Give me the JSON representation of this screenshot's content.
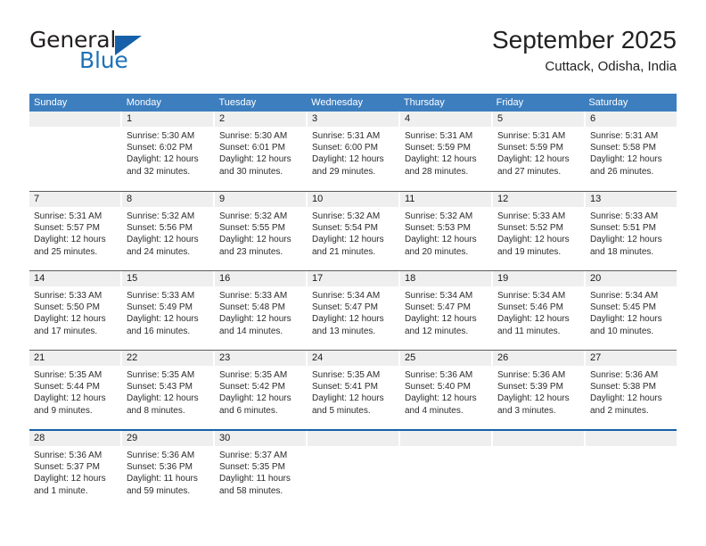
{
  "brand": {
    "name_part1": "General",
    "name_part2": "Blue",
    "flag_icon": "triangle-flag-icon"
  },
  "header": {
    "title": "September 2025",
    "subtitle": "Cuttack, Odisha, India"
  },
  "calendar": {
    "weekday_headers": [
      "Sunday",
      "Monday",
      "Tuesday",
      "Wednesday",
      "Thursday",
      "Friday",
      "Saturday"
    ],
    "accent_color": "#3d7ebf",
    "header_text_color": "#ffffff",
    "day_band_color": "#efefef",
    "weeks": [
      [
        {
          "day": "",
          "empty": true
        },
        {
          "day": "1",
          "sunrise": "Sunrise: 5:30 AM",
          "sunset": "Sunset: 6:02 PM",
          "daylight_line1": "Daylight: 12 hours",
          "daylight_line2": "and 32 minutes."
        },
        {
          "day": "2",
          "sunrise": "Sunrise: 5:30 AM",
          "sunset": "Sunset: 6:01 PM",
          "daylight_line1": "Daylight: 12 hours",
          "daylight_line2": "and 30 minutes."
        },
        {
          "day": "3",
          "sunrise": "Sunrise: 5:31 AM",
          "sunset": "Sunset: 6:00 PM",
          "daylight_line1": "Daylight: 12 hours",
          "daylight_line2": "and 29 minutes."
        },
        {
          "day": "4",
          "sunrise": "Sunrise: 5:31 AM",
          "sunset": "Sunset: 5:59 PM",
          "daylight_line1": "Daylight: 12 hours",
          "daylight_line2": "and 28 minutes."
        },
        {
          "day": "5",
          "sunrise": "Sunrise: 5:31 AM",
          "sunset": "Sunset: 5:59 PM",
          "daylight_line1": "Daylight: 12 hours",
          "daylight_line2": "and 27 minutes."
        },
        {
          "day": "6",
          "sunrise": "Sunrise: 5:31 AM",
          "sunset": "Sunset: 5:58 PM",
          "daylight_line1": "Daylight: 12 hours",
          "daylight_line2": "and 26 minutes."
        }
      ],
      [
        {
          "day": "7",
          "sunrise": "Sunrise: 5:31 AM",
          "sunset": "Sunset: 5:57 PM",
          "daylight_line1": "Daylight: 12 hours",
          "daylight_line2": "and 25 minutes."
        },
        {
          "day": "8",
          "sunrise": "Sunrise: 5:32 AM",
          "sunset": "Sunset: 5:56 PM",
          "daylight_line1": "Daylight: 12 hours",
          "daylight_line2": "and 24 minutes."
        },
        {
          "day": "9",
          "sunrise": "Sunrise: 5:32 AM",
          "sunset": "Sunset: 5:55 PM",
          "daylight_line1": "Daylight: 12 hours",
          "daylight_line2": "and 23 minutes."
        },
        {
          "day": "10",
          "sunrise": "Sunrise: 5:32 AM",
          "sunset": "Sunset: 5:54 PM",
          "daylight_line1": "Daylight: 12 hours",
          "daylight_line2": "and 21 minutes."
        },
        {
          "day": "11",
          "sunrise": "Sunrise: 5:32 AM",
          "sunset": "Sunset: 5:53 PM",
          "daylight_line1": "Daylight: 12 hours",
          "daylight_line2": "and 20 minutes."
        },
        {
          "day": "12",
          "sunrise": "Sunrise: 5:33 AM",
          "sunset": "Sunset: 5:52 PM",
          "daylight_line1": "Daylight: 12 hours",
          "daylight_line2": "and 19 minutes."
        },
        {
          "day": "13",
          "sunrise": "Sunrise: 5:33 AM",
          "sunset": "Sunset: 5:51 PM",
          "daylight_line1": "Daylight: 12 hours",
          "daylight_line2": "and 18 minutes."
        }
      ],
      [
        {
          "day": "14",
          "sunrise": "Sunrise: 5:33 AM",
          "sunset": "Sunset: 5:50 PM",
          "daylight_line1": "Daylight: 12 hours",
          "daylight_line2": "and 17 minutes."
        },
        {
          "day": "15",
          "sunrise": "Sunrise: 5:33 AM",
          "sunset": "Sunset: 5:49 PM",
          "daylight_line1": "Daylight: 12 hours",
          "daylight_line2": "and 16 minutes."
        },
        {
          "day": "16",
          "sunrise": "Sunrise: 5:33 AM",
          "sunset": "Sunset: 5:48 PM",
          "daylight_line1": "Daylight: 12 hours",
          "daylight_line2": "and 14 minutes."
        },
        {
          "day": "17",
          "sunrise": "Sunrise: 5:34 AM",
          "sunset": "Sunset: 5:47 PM",
          "daylight_line1": "Daylight: 12 hours",
          "daylight_line2": "and 13 minutes."
        },
        {
          "day": "18",
          "sunrise": "Sunrise: 5:34 AM",
          "sunset": "Sunset: 5:47 PM",
          "daylight_line1": "Daylight: 12 hours",
          "daylight_line2": "and 12 minutes."
        },
        {
          "day": "19",
          "sunrise": "Sunrise: 5:34 AM",
          "sunset": "Sunset: 5:46 PM",
          "daylight_line1": "Daylight: 12 hours",
          "daylight_line2": "and 11 minutes."
        },
        {
          "day": "20",
          "sunrise": "Sunrise: 5:34 AM",
          "sunset": "Sunset: 5:45 PM",
          "daylight_line1": "Daylight: 12 hours",
          "daylight_line2": "and 10 minutes."
        }
      ],
      [
        {
          "day": "21",
          "sunrise": "Sunrise: 5:35 AM",
          "sunset": "Sunset: 5:44 PM",
          "daylight_line1": "Daylight: 12 hours",
          "daylight_line2": "and 9 minutes."
        },
        {
          "day": "22",
          "sunrise": "Sunrise: 5:35 AM",
          "sunset": "Sunset: 5:43 PM",
          "daylight_line1": "Daylight: 12 hours",
          "daylight_line2": "and 8 minutes."
        },
        {
          "day": "23",
          "sunrise": "Sunrise: 5:35 AM",
          "sunset": "Sunset: 5:42 PM",
          "daylight_line1": "Daylight: 12 hours",
          "daylight_line2": "and 6 minutes."
        },
        {
          "day": "24",
          "sunrise": "Sunrise: 5:35 AM",
          "sunset": "Sunset: 5:41 PM",
          "daylight_line1": "Daylight: 12 hours",
          "daylight_line2": "and 5 minutes."
        },
        {
          "day": "25",
          "sunrise": "Sunrise: 5:36 AM",
          "sunset": "Sunset: 5:40 PM",
          "daylight_line1": "Daylight: 12 hours",
          "daylight_line2": "and 4 minutes."
        },
        {
          "day": "26",
          "sunrise": "Sunrise: 5:36 AM",
          "sunset": "Sunset: 5:39 PM",
          "daylight_line1": "Daylight: 12 hours",
          "daylight_line2": "and 3 minutes."
        },
        {
          "day": "27",
          "sunrise": "Sunrise: 5:36 AM",
          "sunset": "Sunset: 5:38 PM",
          "daylight_line1": "Daylight: 12 hours",
          "daylight_line2": "and 2 minutes."
        }
      ],
      [
        {
          "day": "28",
          "sunrise": "Sunrise: 5:36 AM",
          "sunset": "Sunset: 5:37 PM",
          "daylight_line1": "Daylight: 12 hours",
          "daylight_line2": "and 1 minute."
        },
        {
          "day": "29",
          "sunrise": "Sunrise: 5:36 AM",
          "sunset": "Sunset: 5:36 PM",
          "daylight_line1": "Daylight: 11 hours",
          "daylight_line2": "and 59 minutes."
        },
        {
          "day": "30",
          "sunrise": "Sunrise: 5:37 AM",
          "sunset": "Sunset: 5:35 PM",
          "daylight_line1": "Daylight: 11 hours",
          "daylight_line2": "and 58 minutes."
        },
        {
          "day": "",
          "empty": true
        },
        {
          "day": "",
          "empty": true
        },
        {
          "day": "",
          "empty": true
        },
        {
          "day": "",
          "empty": true
        }
      ]
    ]
  }
}
